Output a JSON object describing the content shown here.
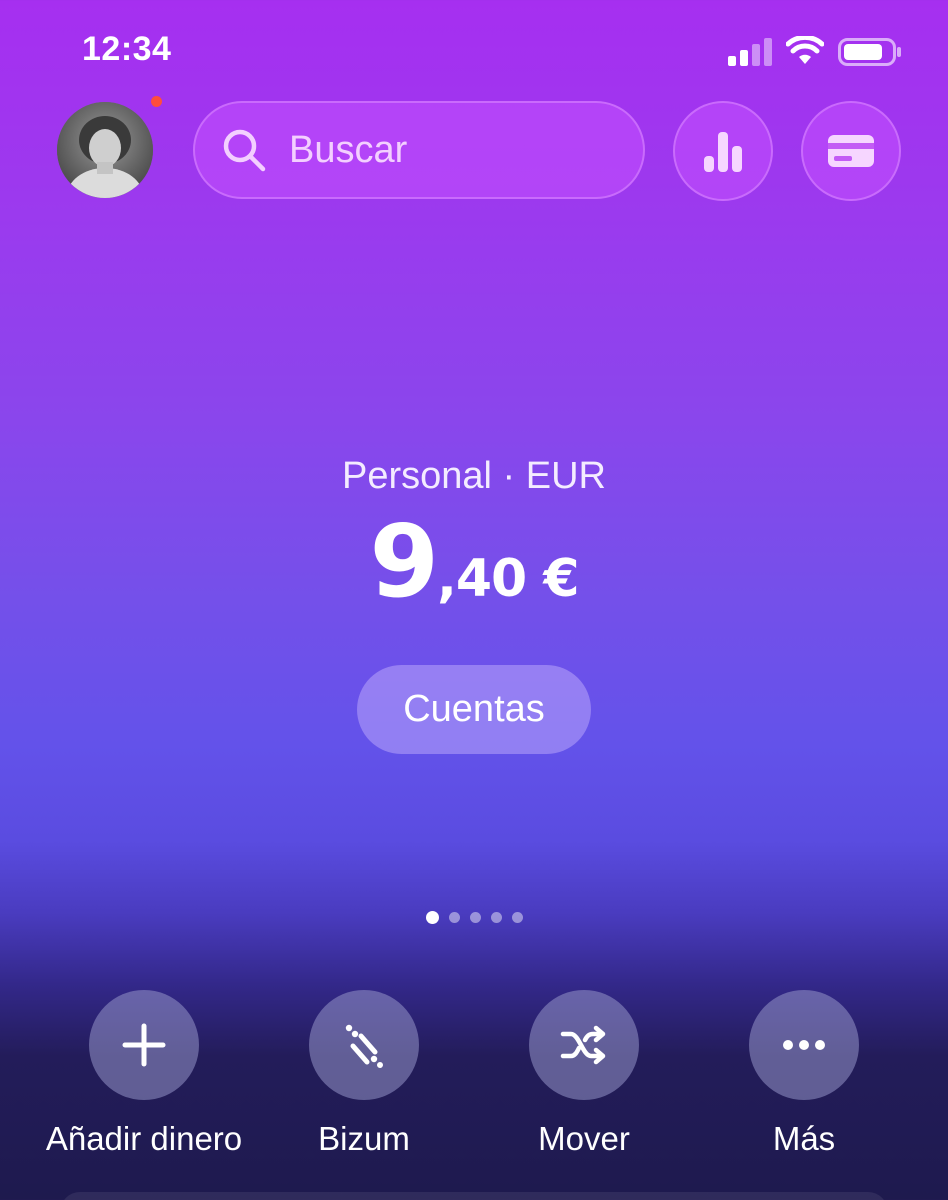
{
  "status_bar": {
    "time": "12:34",
    "signal_icon": "cellular-signal-icon",
    "wifi_icon": "wifi-icon",
    "battery_icon": "battery-icon"
  },
  "header": {
    "avatar": "profile-avatar",
    "notification_color": "#ff4d3d",
    "search_placeholder": "Buscar",
    "search_icon": "search-icon",
    "stats_icon": "bar-chart-icon",
    "card_icon": "credit-card-icon"
  },
  "balance": {
    "account_label": "Personal · EUR",
    "whole": "9",
    "decimals": ",40 €",
    "accounts_button": "Cuentas"
  },
  "pager": {
    "total": 5,
    "active_index": 0
  },
  "actions": [
    {
      "label": "Añadir dinero",
      "icon": "plus-icon"
    },
    {
      "label": "Bizum",
      "icon": "bizum-icon"
    },
    {
      "label": "Mover",
      "icon": "shuffle-icon"
    },
    {
      "label": "Más",
      "icon": "more-dots-icon"
    }
  ],
  "colors": {
    "gradient_top": "#a62ff0",
    "gradient_mid": "#6352ea",
    "gradient_bottom": "#1e1a4e"
  }
}
